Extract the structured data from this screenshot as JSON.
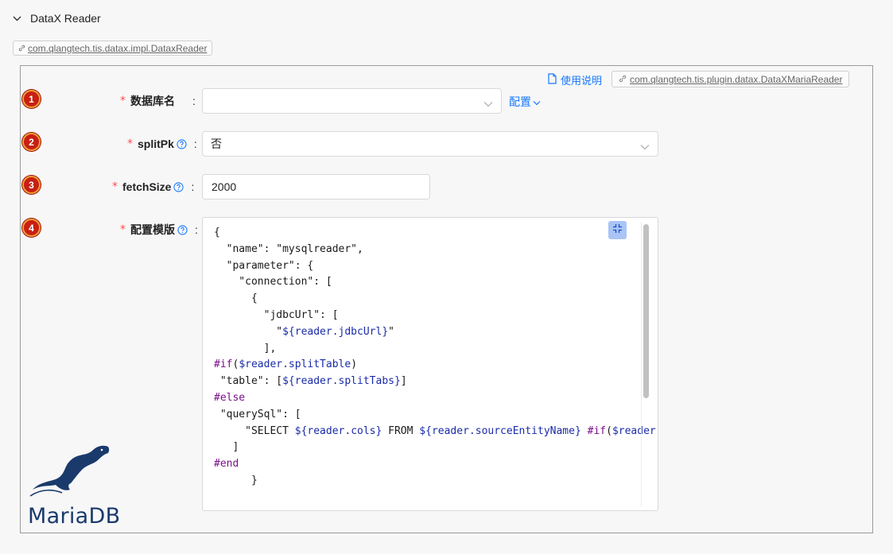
{
  "panel": {
    "title": "DataX Reader"
  },
  "impl_tag": "com.qlangtech.tis.datax.impl.DataxReader",
  "doc_link": "使用说明",
  "plugin_tag": "com.qlangtech.tis.plugin.datax.DataXMariaReader",
  "fields": [
    {
      "badge": "1",
      "label": "数据库名",
      "value": "",
      "extra_link": "配置"
    },
    {
      "badge": "2",
      "label": "splitPk",
      "value": "否"
    },
    {
      "badge": "3",
      "label": "fetchSize",
      "value": "2000"
    },
    {
      "badge": "4",
      "label": "配置模版"
    }
  ],
  "required_mark": "*",
  "colon": ":",
  "editor": {
    "code_lines": [
      "{",
      "  \"name\": \"mysqlreader\",",
      "  \"parameter\": {",
      "    \"connection\": [",
      "      {",
      "        \"jdbcUrl\": [",
      "          \"${reader.jdbcUrl}\"",
      "        ],",
      "#if($reader.splitTable)",
      " \"table\": [${reader.splitTabs}]",
      "#else",
      " \"querySql\": [",
      "     \"SELECT ${reader.cols} FROM ${reader.sourceEntityName} #if($reader.containWhere) WHERE ${reader.where} #end\"",
      "   ]",
      "#end",
      "      }"
    ]
  },
  "logo": {
    "text": "MariaDB",
    "icon": "mariadb-seal-logo"
  },
  "colors": {
    "link": "#1677ff",
    "required": "#ff4d4f",
    "badge": "#c81f12",
    "keyword": "#7a0f8a",
    "variable": "#1a2ba8"
  }
}
